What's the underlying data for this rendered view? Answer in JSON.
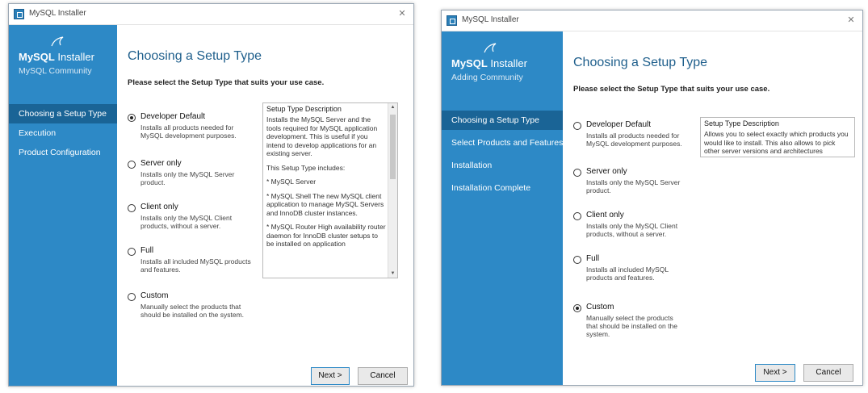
{
  "left": {
    "window_title": "MySQL Installer",
    "brand": {
      "name_a": "MySQL",
      "name_b": " Installer",
      "edition": "MySQL Community"
    },
    "steps": [
      {
        "label": "Choosing a Setup Type"
      },
      {
        "label": "Execution"
      },
      {
        "label": "Product Configuration"
      }
    ],
    "heading": "Choosing a Setup Type",
    "subheading": "Please select the Setup Type that suits your use case.",
    "options": [
      {
        "name": "Developer Default",
        "desc": "Installs all products needed for MySQL development purposes.",
        "selected": true
      },
      {
        "name": "Server only",
        "desc": "Installs only the MySQL Server product.",
        "selected": false
      },
      {
        "name": "Client only",
        "desc": "Installs only the MySQL Client products, without a server.",
        "selected": false
      },
      {
        "name": "Full",
        "desc": "Installs all included MySQL products and features.",
        "selected": false
      },
      {
        "name": "Custom",
        "desc": "Manually select the products that should be installed on the system.",
        "selected": false
      }
    ],
    "panel": {
      "title": "Setup Type Description",
      "paragraphs": [
        "Installs the MySQL Server and the tools required for MySQL application development. This is useful if you intend to develop applications for an existing server.",
        "This Setup Type includes:",
        "* MySQL Server",
        "* MySQL Shell The new MySQL client application to manage MySQL Servers and InnoDB cluster instances.",
        "* MySQL Router High availability router daemon for InnoDB cluster setups to be installed on application"
      ]
    },
    "buttons": {
      "next": "Next >",
      "cancel": "Cancel"
    }
  },
  "right": {
    "window_title": "MySQL Installer",
    "brand": {
      "name_a": "MySQL",
      "name_b": " Installer",
      "edition": "Adding Community"
    },
    "steps": [
      {
        "label": "Choosing a Setup Type"
      },
      {
        "label": "Select Products and Features"
      },
      {
        "label": "Installation"
      },
      {
        "label": "Installation Complete"
      }
    ],
    "heading": "Choosing a Setup Type",
    "subheading": "Please select the Setup Type that suits your use case.",
    "options": [
      {
        "name": "Developer Default",
        "desc": "Installs all products needed for MySQL development purposes.",
        "selected": false
      },
      {
        "name": "Server only",
        "desc": "Installs only the MySQL Server product.",
        "selected": false
      },
      {
        "name": "Client only",
        "desc": "Installs only the MySQL Client products, without a server.",
        "selected": false
      },
      {
        "name": "Full",
        "desc": "Installs all included MySQL products and features.",
        "selected": false
      },
      {
        "name": "Custom",
        "desc": "Manually select the products that should be installed on the system.",
        "selected": true
      }
    ],
    "panel": {
      "title": "Setup Type Description",
      "paragraphs": [
        "Allows you to select exactly which products you would like to install. This also allows to pick other server versions and architectures (depending on your OS)."
      ]
    },
    "buttons": {
      "next": "Next >",
      "cancel": "Cancel"
    }
  },
  "colors": {
    "sidebar": "#2d89c6",
    "sidebar_active": "#1a6496",
    "heading": "#1f5f8c"
  },
  "icons": {
    "app": "mysql-installer-icon",
    "logo": "dolphin-icon",
    "close": "close-icon"
  }
}
